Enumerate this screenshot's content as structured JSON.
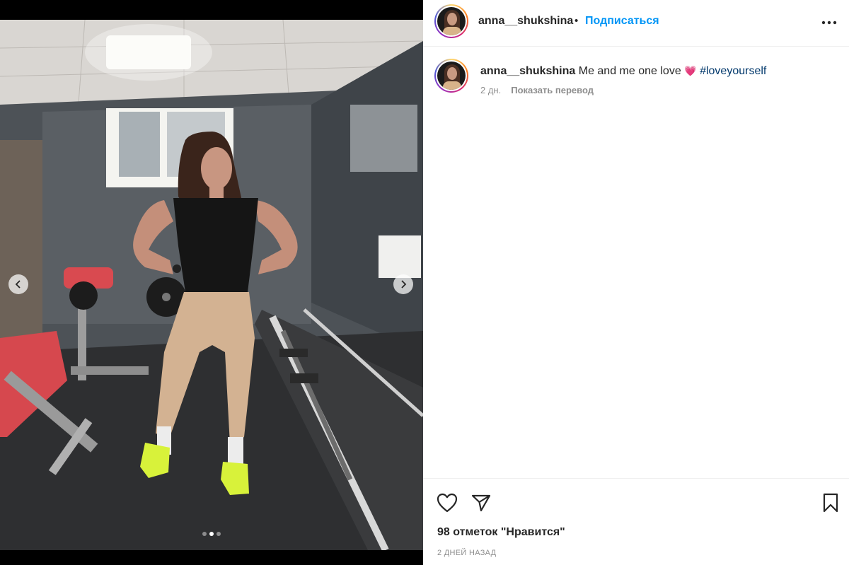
{
  "header": {
    "username": "anna__shukshina",
    "separator": "•",
    "follow_label": "Подписаться"
  },
  "caption": {
    "username": "anna__shukshina",
    "text": "Me and me one love",
    "emoji": "💗",
    "hashtag": "#loveyourself",
    "age": "2 дн.",
    "translate_label": "Показать перевод"
  },
  "carousel": {
    "slide_count": 3,
    "active_slide": 2
  },
  "actions": {
    "likes_text": "98 отметок \"Нравится\"",
    "timestamp": "2 ДНЕЙ НАЗАД"
  },
  "icons": {
    "like": "heart-outline-icon",
    "share": "paper-plane-icon",
    "save": "bookmark-outline-icon",
    "more": "three-dots-icon",
    "prev": "chevron-left-icon",
    "next": "chevron-right-icon"
  },
  "colors": {
    "accent": "#0095f6",
    "hashtag": "#00376b",
    "muted": "#8e8e8e",
    "text": "#262626"
  }
}
